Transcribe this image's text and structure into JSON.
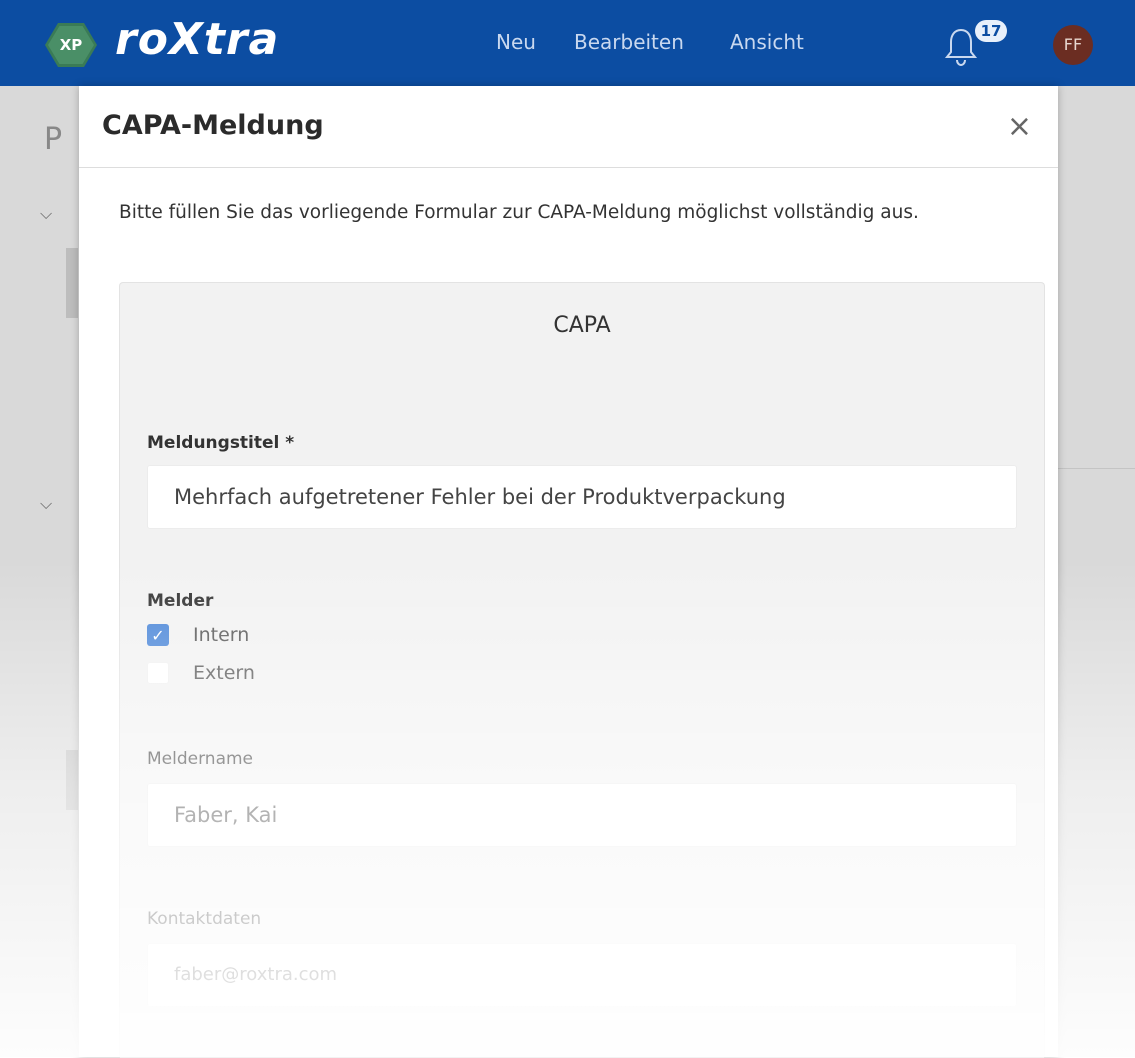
{
  "app": {
    "logo_badge": "XP",
    "logo_text": "roXtra",
    "nav": {
      "neu": "Neu",
      "bearbeiten": "Bearbeiten",
      "ansicht": "Ansicht"
    },
    "notification_count": "17",
    "avatar_initials": "FF",
    "colors": {
      "header": "#0c4da2",
      "logo_green": "#3a7b56",
      "avatar": "#6b2d22",
      "check_blue": "#4a86d8"
    }
  },
  "background": {
    "title_fragment": "P"
  },
  "modal": {
    "title": "CAPA-Meldung",
    "close_symbol": "×",
    "intro": "Bitte füllen Sie das vorliegende Formular zur CAPA-Meldung möglichst vollständig aus.",
    "panel_title": "CAPA",
    "fields": {
      "meldungstitel": {
        "label": "Meldungstitel *",
        "value": "Mehrfach aufgetretener Fehler bei der Produktverpackung"
      },
      "melder": {
        "label": "Melder",
        "options": [
          {
            "label": "Intern",
            "checked": true
          },
          {
            "label": "Extern",
            "checked": false
          }
        ]
      },
      "meldername": {
        "label": "Meldername",
        "value": "Faber, Kai"
      },
      "kontaktdaten": {
        "label": "Kontaktdaten",
        "value": "faber@roxtra.com"
      }
    }
  }
}
